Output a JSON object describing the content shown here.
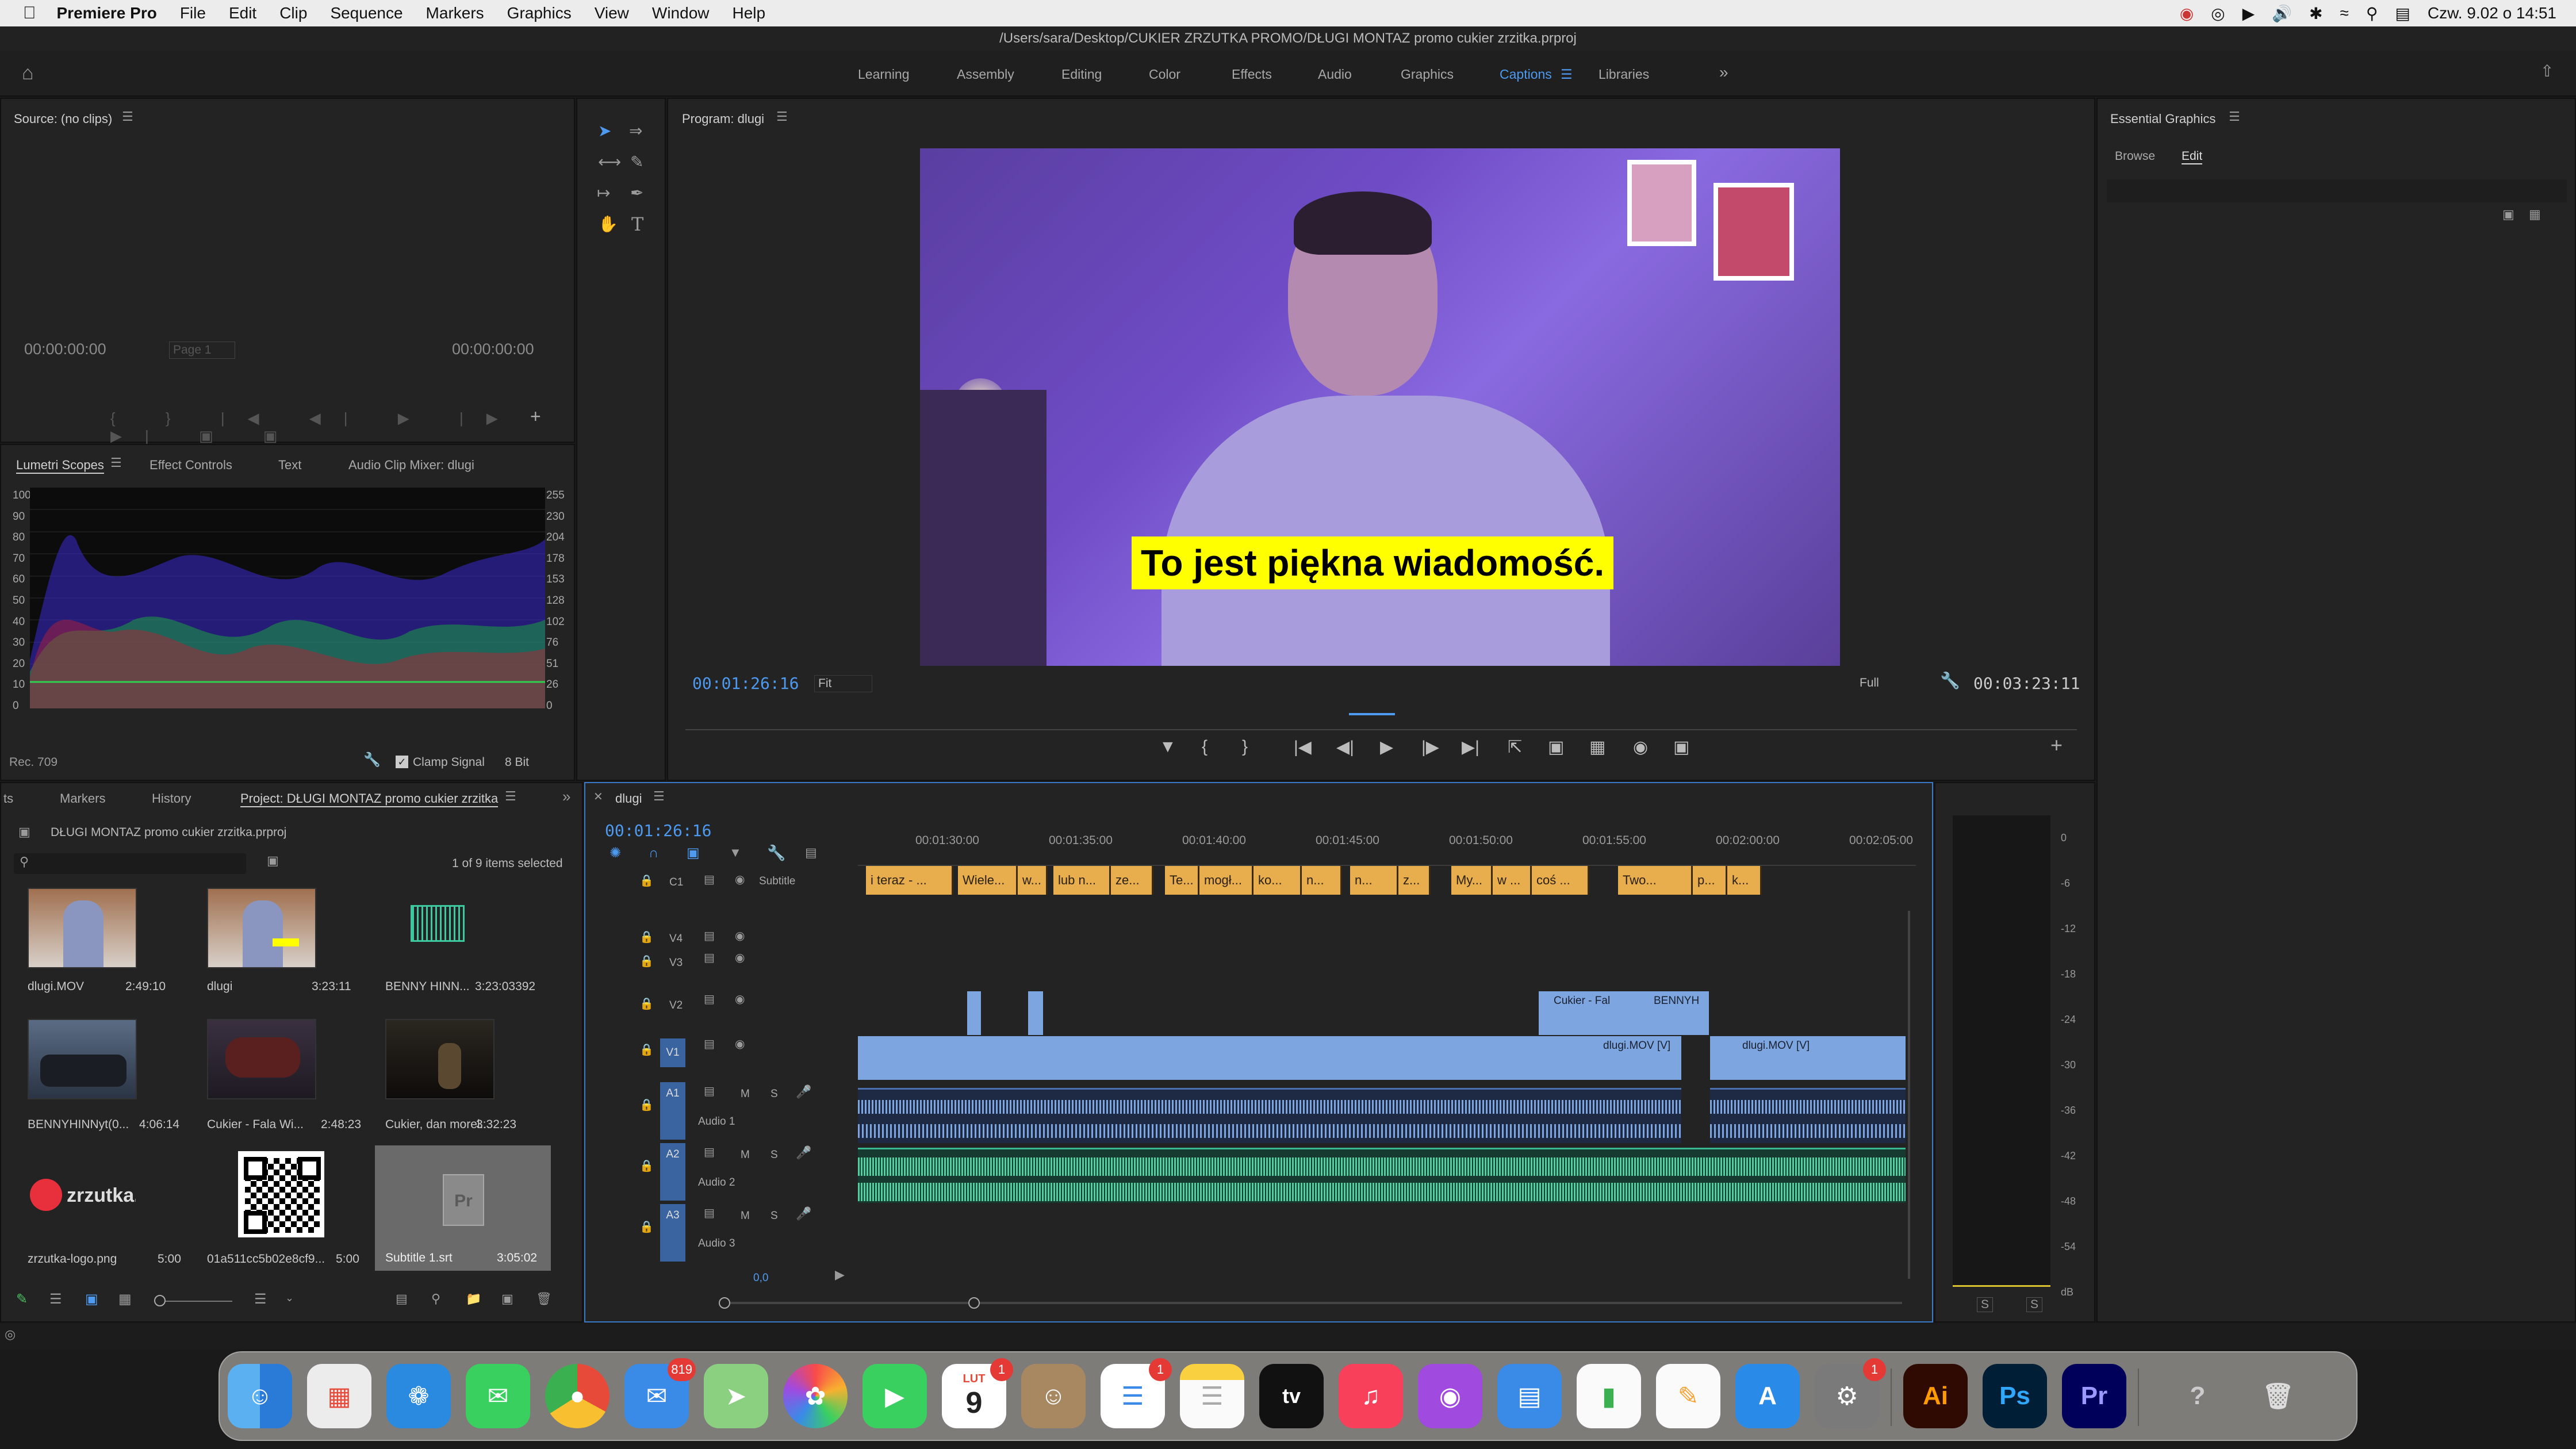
{
  "menubar": {
    "app": "Premiere Pro",
    "items": [
      "File",
      "Edit",
      "Clip",
      "Sequence",
      "Markers",
      "Graphics",
      "View",
      "Window",
      "Help"
    ],
    "clock": "Czw. 9.02 o 14:51"
  },
  "titlebar": {
    "path": "/Users/sara/Desktop/CUKIER ZRZUTKA PROMO/DŁUGI MONTAZ promo cukier zrzitka.prproj"
  },
  "workspaces": [
    "Learning",
    "Assembly",
    "Editing",
    "Color",
    "Effects",
    "Audio",
    "Graphics",
    "Captions",
    "Libraries"
  ],
  "source": {
    "title": "Source: (no clips)",
    "tc_left": "00:00:00:00",
    "page": "Page 1",
    "tc_right": "00:00:00:00"
  },
  "scopes": {
    "tabs": [
      "Lumetri Scopes",
      "Effect Controls",
      "Text",
      "Audio Clip Mixer: dlugi"
    ],
    "left_scale": [
      "100",
      "90",
      "80",
      "70",
      "60",
      "50",
      "40",
      "30",
      "20",
      "10",
      "0"
    ],
    "right_scale": [
      "255",
      "230",
      "204",
      "178",
      "153",
      "128",
      "102",
      "76",
      "51",
      "26",
      "0"
    ],
    "footer_left": "Rec. 709",
    "clamp": "Clamp Signal",
    "bit": "8 Bit"
  },
  "program": {
    "title": "Program: dlugi",
    "caption": "To jest piękna wiadomość.",
    "tc_current": "00:01:26:16",
    "fit": "Fit",
    "quality": "Full",
    "tc_duration": "00:03:23:11"
  },
  "essential": {
    "title": "Essential Graphics",
    "tabs": [
      "Browse",
      "Edit"
    ]
  },
  "project": {
    "tabs": [
      "ts",
      "Markers",
      "History",
      "Project: DŁUGI MONTAZ promo cukier zrzitka"
    ],
    "file": "DŁUGI MONTAZ promo cukier zrzitka.prproj",
    "selected": "1 of 9 items selected",
    "items": [
      {
        "name": "dlugi.MOV",
        "dur": "2:49:10"
      },
      {
        "name": "dlugi",
        "dur": "3:23:11"
      },
      {
        "name": "BENNY HINN...",
        "dur": "3:23:03392"
      },
      {
        "name": "BENNYHINNyt(0...",
        "dur": "4:06:14"
      },
      {
        "name": "Cukier - Fala Wi...",
        "dur": "2:48:23"
      },
      {
        "name": "Cukier, dan morel...",
        "dur": "3:32:23"
      },
      {
        "name": "zrzutka-logo.png",
        "dur": "5:00"
      },
      {
        "name": "01a511cc5b02e8cf9...",
        "dur": "5:00"
      },
      {
        "name": "Subtitle 1.srt",
        "dur": "3:05:02"
      }
    ],
    "logo_text": "zrzutka.pl"
  },
  "timeline": {
    "title": "dlugi",
    "tc": "00:01:26:16",
    "ruler": [
      "00:01:30:00",
      "00:01:35:00",
      "00:01:40:00",
      "00:01:45:00",
      "00:01:50:00",
      "00:01:55:00",
      "00:02:00:00",
      "00:02:05:00"
    ],
    "subtitle_track": "Subtitle",
    "c1": "C1",
    "tracks_v": [
      "V4",
      "V3",
      "V2",
      "V1"
    ],
    "tracks_a": [
      {
        "id": "A1",
        "name": "Audio 1"
      },
      {
        "id": "A2",
        "name": "Audio 2"
      },
      {
        "id": "A3",
        "name": "Audio 3"
      }
    ],
    "captions": [
      "i teraz - ...",
      "Wiele...",
      "w...",
      "lub n...",
      "ze...",
      "Te...",
      "mogł...",
      "ko...",
      "n...",
      "n...",
      "z...",
      "My...",
      "w ...",
      "coś ...",
      "Two...",
      "p...",
      "k..."
    ],
    "clips": {
      "v2a": "Cukier - Fal",
      "v2b": "BENNYH",
      "v1a": "dlugi.MOV [V]",
      "v1b": "dlugi.MOV [V]"
    },
    "zoom_value": "0,0",
    "m": "M",
    "s": "S"
  },
  "meter": {
    "scale": [
      "0",
      "-6",
      "-12",
      "-18",
      "-24",
      "-30",
      "-36",
      "-42",
      "-48",
      "-54",
      "dB"
    ],
    "solo": [
      "S",
      "S"
    ]
  },
  "dock": {
    "mail_badge": "819",
    "calendar_month": "LUT",
    "calendar_day": "9",
    "calendar_badge": "1",
    "reminders_badge": "1",
    "settings_badge": "1",
    "ai": "Ai",
    "ps": "Ps",
    "pr": "Pr"
  }
}
